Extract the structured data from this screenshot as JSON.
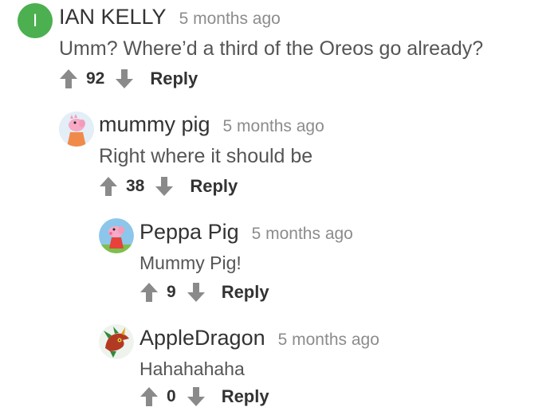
{
  "comments": [
    {
      "avatar_letter": "I",
      "avatar_color": "#4caf50",
      "author": "IAN KELLY",
      "time": "5 months ago",
      "text": "Umm? Where’d a third of the Oreos go already?",
      "score": "92",
      "reply_label": "Reply"
    },
    {
      "avatar_icon": "mummy-pig-icon",
      "author": "mummy pig",
      "time": "5 months ago",
      "text": "Right where it should be",
      "score": "38",
      "reply_label": "Reply"
    },
    {
      "avatar_icon": "peppa-pig-icon",
      "author": "Peppa Pig",
      "time": "5 months ago",
      "text": "Mummy Pig!",
      "score": "9",
      "reply_label": "Reply"
    },
    {
      "avatar_icon": "dragon-icon",
      "author": "AppleDragon",
      "time": "5 months ago",
      "text": "Hahahahaha",
      "score": "0",
      "reply_label": "Reply"
    }
  ]
}
